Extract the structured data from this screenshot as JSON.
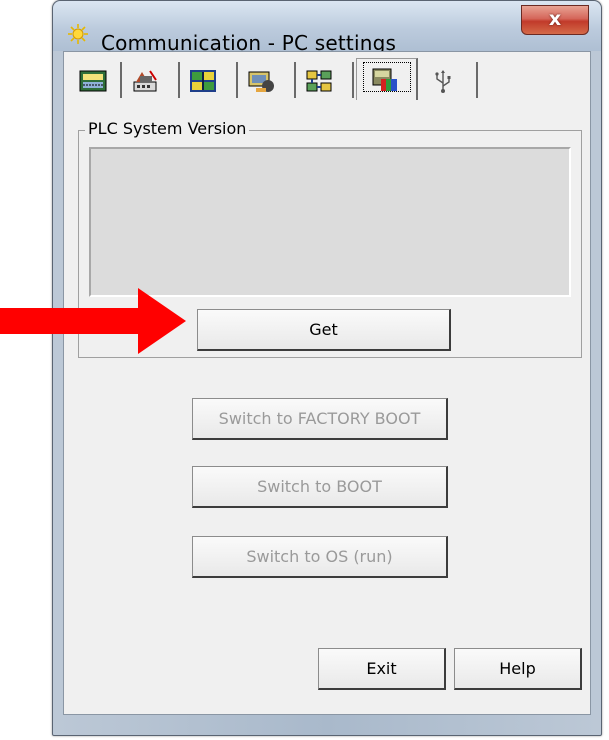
{
  "window": {
    "title": "Communication - PC settings",
    "close_symbol": "x"
  },
  "tabs": [
    {
      "name": "tab-display",
      "icon": "display-panel-icon",
      "active": false
    },
    {
      "name": "tab-network",
      "icon": "network-device-icon",
      "active": false
    },
    {
      "name": "tab-modules",
      "icon": "plc-modules-icon",
      "active": false
    },
    {
      "name": "tab-connection",
      "icon": "connection-icon",
      "active": false
    },
    {
      "name": "tab-nodes",
      "icon": "network-nodes-icon",
      "active": false
    },
    {
      "name": "tab-system",
      "icon": "system-version-icon",
      "active": true
    },
    {
      "name": "tab-usb",
      "icon": "usb-icon",
      "active": false
    }
  ],
  "group": {
    "legend": "PLC System Version",
    "version_text": ""
  },
  "buttons": {
    "get": "Get",
    "factory_boot": "Switch to FACTORY BOOT",
    "boot": "Switch to BOOT",
    "os_run": "Switch to OS (run)",
    "exit": "Exit",
    "help": "Help"
  },
  "colors": {
    "arrow": "#ff0000",
    "close_button": "#c9483a"
  }
}
